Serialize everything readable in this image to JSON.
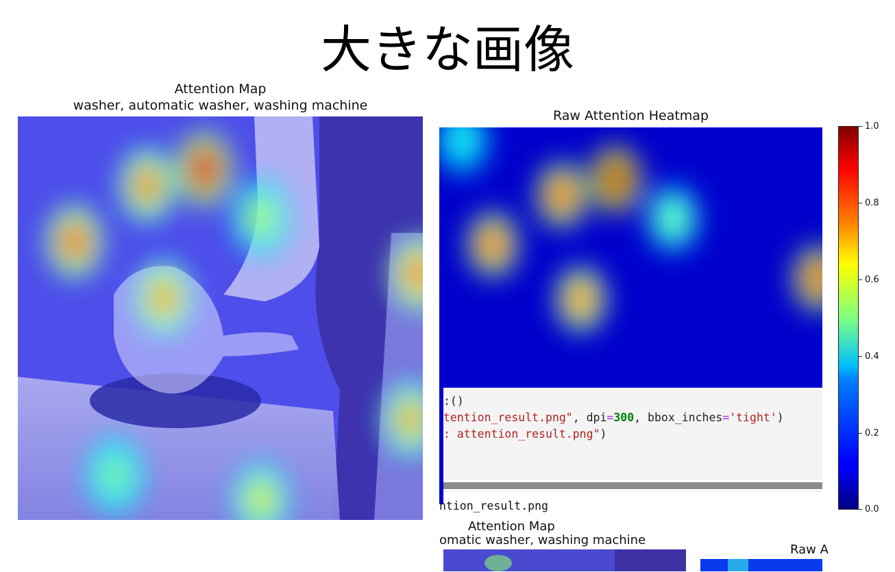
{
  "figure": {
    "suptitle": "大きな画像"
  },
  "left_panel": {
    "title_line1": "Attention Map",
    "title_line2": "washer, automatic washer, washing machine"
  },
  "right_panel": {
    "title": "Raw Attention Heatmap"
  },
  "colorbar": {
    "ticks": [
      "1.0",
      "0.8",
      "0.6",
      "0.4",
      "0.2",
      "0.0"
    ]
  },
  "overlay_notebook": {
    "code_line1": ":()",
    "code_line2_a": "tention_result.png\"",
    "code_line2_b": ", dpi",
    "code_line2_c": "=",
    "code_line2_d": "300",
    "code_line2_e": ", bbox_inches",
    "code_line2_f": "=",
    "code_line2_g": "'tight'",
    "code_line2_h": ")",
    "code_line3_a": ": attention_result.png\"",
    "code_line3_b": ")",
    "output_line": "ntion_result.png",
    "nested_title_line1": "Attention Map",
    "nested_title_line2": "omatic washer, washing machine",
    "nested_right_title": "Raw A"
  },
  "colors": {
    "heat_background": "#0000cc",
    "overlay_tint": "#5a5aff"
  },
  "chart_data": [
    {
      "type": "heatmap",
      "title": "Attention Map\nwasher, automatic washer, washing machine",
      "xlabel": "",
      "ylabel": "",
      "overlay_on": "photo",
      "peak_spots": [
        {
          "x": 0.46,
          "y": 0.13,
          "value": 0.9
        },
        {
          "x": 0.32,
          "y": 0.17,
          "value": 0.75
        },
        {
          "x": 0.14,
          "y": 0.31,
          "value": 0.8
        },
        {
          "x": 0.36,
          "y": 0.45,
          "value": 0.72
        },
        {
          "x": 0.99,
          "y": 0.39,
          "value": 0.78
        },
        {
          "x": 0.97,
          "y": 0.75,
          "value": 0.7
        },
        {
          "x": 0.24,
          "y": 0.89,
          "value": 0.5
        },
        {
          "x": 0.6,
          "y": 0.95,
          "value": 0.6
        },
        {
          "x": 0.6,
          "y": 0.25,
          "value": 0.55
        }
      ]
    },
    {
      "type": "heatmap",
      "title": "Raw Attention Heatmap",
      "xlabel": "",
      "ylabel": "",
      "colorbar": {
        "min": 0.0,
        "max": 1.0,
        "ticks": [
          0.0,
          0.2,
          0.4,
          0.6,
          0.8,
          1.0
        ],
        "colormap": "jet"
      },
      "peak_spots": [
        {
          "x": 0.46,
          "y": 0.2,
          "value": 1.0
        },
        {
          "x": 0.32,
          "y": 0.26,
          "value": 0.88
        },
        {
          "x": 0.14,
          "y": 0.45,
          "value": 0.86
        },
        {
          "x": 0.37,
          "y": 0.66,
          "value": 0.82
        },
        {
          "x": 0.99,
          "y": 0.58,
          "value": 0.9
        },
        {
          "x": 0.61,
          "y": 0.35,
          "value": 0.5
        },
        {
          "x": 0.06,
          "y": 0.05,
          "value": 0.4
        }
      ]
    }
  ]
}
